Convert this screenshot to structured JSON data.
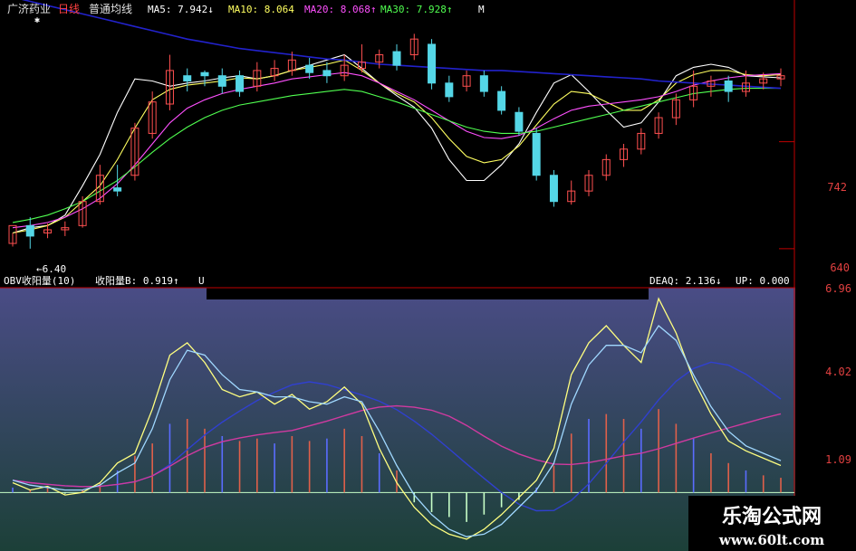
{
  "header": {
    "stock_name": "广济药业",
    "period": "日线",
    "indicator_name": "普通均线",
    "ma5": "MA5: 7.942↓",
    "ma10": "MA10: 8.064",
    "ma20": "MA20: 8.068↑",
    "ma30": "MA30: 7.928↑",
    "overflow_mark": "M"
  },
  "price_panel": {
    "min_marker": "6.40",
    "axis_labels": [
      "742",
      "640"
    ]
  },
  "sub_panel": {
    "indicator_title": "OBV收阳量(10)",
    "field1": "收阳量B: 0.919↑",
    "clipped_mark": "U",
    "field2": "DEAQ: 2.136↓",
    "field3": "UP: 0.000",
    "axis_labels": [
      "6.96",
      "4.02",
      "1.09"
    ]
  },
  "watermark": {
    "brand": "乐淘公式网",
    "url": "www.60lt.com"
  },
  "colors": {
    "background": "#000000",
    "up_candle": "#ff5050",
    "down_candle": "#54d6e6",
    "ma5": "#ffffff",
    "ma10": "#ffff60",
    "ma20": "#ff50ff",
    "ma30": "#50ff50",
    "long_ma": "#2222cc",
    "axis": "#c00000",
    "sub_bg_top": "#4a4c86",
    "sub_bg_bottom": "#1c4038"
  },
  "chart_data": [
    {
      "type": "candlestick",
      "title": "广济药业 日线",
      "ylim": [
        6.2,
        8.6
      ],
      "axis_labels": [
        "742",
        "640"
      ],
      "min_annotation": 6.4,
      "series": [
        {
          "name": "MA5",
          "values": [
            6.55,
            6.6,
            6.62,
            6.72,
            7.0,
            7.3,
            7.7,
            8.02,
            8.0,
            7.95,
            7.98,
            8.0,
            8.03,
            8.05,
            8.02,
            8.05,
            8.1,
            8.15,
            8.2,
            8.25,
            8.12,
            7.98,
            7.86,
            7.75,
            7.55,
            7.25,
            7.05,
            7.05,
            7.2,
            7.4,
            7.7,
            7.98,
            8.06,
            7.9,
            7.72,
            7.56,
            7.6,
            7.8,
            8.05,
            8.13,
            8.16,
            8.13,
            8.05,
            8.04,
            8.03
          ]
        },
        {
          "name": "MA10",
          "values": [
            6.55,
            6.58,
            6.62,
            6.7,
            6.85,
            7.0,
            7.25,
            7.55,
            7.82,
            7.92,
            7.96,
            7.98,
            8.0,
            8.03,
            8.02,
            8.05,
            8.1,
            8.13,
            8.16,
            8.2,
            8.1,
            7.98,
            7.88,
            7.8,
            7.65,
            7.45,
            7.28,
            7.22,
            7.25,
            7.38,
            7.58,
            7.78,
            7.9,
            7.88,
            7.8,
            7.72,
            7.72,
            7.82,
            7.98,
            8.06,
            8.1,
            8.1,
            8.06,
            8.05,
            8.06
          ]
        },
        {
          "name": "MA20",
          "values": [
            6.6,
            6.62,
            6.65,
            6.7,
            6.78,
            6.88,
            7.02,
            7.2,
            7.4,
            7.6,
            7.74,
            7.82,
            7.88,
            7.92,
            7.95,
            7.98,
            8.02,
            8.04,
            8.06,
            8.08,
            8.05,
            7.98,
            7.9,
            7.82,
            7.72,
            7.62,
            7.52,
            7.46,
            7.45,
            7.48,
            7.55,
            7.64,
            7.72,
            7.76,
            7.78,
            7.8,
            7.82,
            7.85,
            7.9,
            7.96,
            8.0,
            8.03,
            8.05,
            8.06,
            8.07
          ]
        },
        {
          "name": "MA30",
          "values": [
            6.65,
            6.68,
            6.72,
            6.78,
            6.85,
            6.95,
            7.05,
            7.18,
            7.32,
            7.45,
            7.56,
            7.65,
            7.72,
            7.77,
            7.8,
            7.83,
            7.86,
            7.88,
            7.9,
            7.92,
            7.9,
            7.85,
            7.8,
            7.74,
            7.68,
            7.62,
            7.56,
            7.52,
            7.5,
            7.5,
            7.52,
            7.56,
            7.6,
            7.64,
            7.68,
            7.72,
            7.76,
            7.8,
            7.84,
            7.88,
            7.9,
            7.92,
            7.93,
            7.93,
            7.93
          ]
        },
        {
          "name": "long MA",
          "values": [
            8.8,
            8.76,
            8.72,
            8.68,
            8.64,
            8.6,
            8.56,
            8.52,
            8.48,
            8.44,
            8.4,
            8.37,
            8.34,
            8.31,
            8.29,
            8.27,
            8.25,
            8.23,
            8.21,
            8.2,
            8.18,
            8.16,
            8.15,
            8.14,
            8.13,
            8.12,
            8.11,
            8.1,
            8.1,
            8.09,
            8.08,
            8.07,
            8.06,
            8.05,
            8.04,
            8.03,
            8.02,
            8.0,
            7.99,
            7.98,
            7.97,
            7.96,
            7.95,
            7.94,
            7.93
          ]
        }
      ],
      "candles": [
        [
          6.45,
          6.62,
          6.55,
          6.42
        ],
        [
          6.62,
          6.52,
          6.7,
          6.4
        ],
        [
          6.55,
          6.58,
          6.64,
          6.5
        ],
        [
          6.58,
          6.6,
          6.66,
          6.52
        ],
        [
          6.62,
          6.85,
          6.9,
          6.6
        ],
        [
          6.85,
          7.1,
          7.2,
          6.82
        ],
        [
          6.98,
          6.95,
          7.2,
          6.9
        ],
        [
          7.1,
          7.55,
          7.6,
          7.05
        ],
        [
          7.5,
          7.8,
          7.9,
          7.45
        ],
        [
          7.78,
          8.1,
          8.25,
          7.72
        ],
        [
          8.05,
          8.0,
          8.12,
          7.9
        ],
        [
          8.08,
          8.05,
          8.1,
          7.95
        ],
        [
          8.05,
          7.95,
          8.12,
          7.88
        ],
        [
          8.05,
          7.9,
          8.1,
          7.85
        ],
        [
          7.95,
          8.1,
          8.18,
          7.9
        ],
        [
          8.05,
          8.12,
          8.2,
          8.0
        ],
        [
          8.1,
          8.2,
          8.28,
          8.05
        ],
        [
          8.15,
          8.08,
          8.22,
          8.02
        ],
        [
          8.1,
          8.05,
          8.18,
          7.98
        ],
        [
          8.05,
          8.15,
          8.25,
          8.0
        ],
        [
          8.12,
          8.18,
          8.35,
          8.08
        ],
        [
          8.18,
          8.25,
          8.3,
          8.12
        ],
        [
          8.28,
          8.15,
          8.35,
          8.1
        ],
        [
          8.25,
          8.4,
          8.45,
          8.2
        ],
        [
          8.35,
          7.98,
          8.4,
          7.92
        ],
        [
          7.98,
          7.85,
          8.05,
          7.8
        ],
        [
          7.95,
          8.05,
          8.1,
          7.9
        ],
        [
          8.05,
          7.9,
          8.1,
          7.85
        ],
        [
          7.9,
          7.72,
          7.95,
          7.68
        ],
        [
          7.7,
          7.52,
          7.75,
          7.48
        ],
        [
          7.5,
          7.1,
          7.55,
          7.05
        ],
        [
          7.1,
          6.85,
          7.15,
          6.8
        ],
        [
          6.85,
          6.95,
          7.05,
          6.82
        ],
        [
          6.95,
          7.1,
          7.15,
          6.9
        ],
        [
          7.1,
          7.25,
          7.3,
          7.05
        ],
        [
          7.25,
          7.35,
          7.4,
          7.18
        ],
        [
          7.35,
          7.5,
          7.55,
          7.3
        ],
        [
          7.5,
          7.65,
          7.7,
          7.45
        ],
        [
          7.65,
          7.82,
          7.88,
          7.58
        ],
        [
          7.82,
          7.95,
          8.1,
          7.75
        ],
        [
          7.95,
          8.0,
          8.05,
          7.85
        ],
        [
          8.0,
          7.9,
          8.05,
          7.8
        ],
        [
          7.9,
          7.98,
          8.1,
          7.85
        ],
        [
          7.98,
          8.02,
          8.08,
          7.92
        ],
        [
          8.02,
          8.05,
          8.12,
          7.95
        ]
      ]
    },
    {
      "type": "line",
      "title": "OBV收阳量(10)",
      "ylim": [
        -2.2,
        8.2
      ],
      "axis_labels": [
        "6.96",
        "4.02",
        "1.09"
      ],
      "series": [
        {
          "name": "收阳量B",
          "values": [
            0.4,
            0.1,
            0.25,
            -0.1,
            0.0,
            0.4,
            1.2,
            1.6,
            3.4,
            5.6,
            6.1,
            5.3,
            4.2,
            3.9,
            4.1,
            3.6,
            4.0,
            3.4,
            3.7,
            4.3,
            3.6,
            1.8,
            0.4,
            -0.6,
            -1.3,
            -1.7,
            -1.9,
            -1.5,
            -0.9,
            -0.2,
            0.5,
            1.8,
            4.8,
            6.1,
            6.8,
            6.0,
            5.3,
            7.9,
            6.5,
            4.6,
            3.2,
            2.1,
            1.7,
            1.4,
            1.1
          ]
        },
        {
          "name": "DEAQ",
          "values": [
            0.5,
            0.3,
            0.2,
            0.1,
            0.1,
            0.3,
            0.8,
            1.2,
            2.6,
            4.6,
            5.8,
            5.6,
            4.8,
            4.2,
            4.1,
            3.9,
            3.9,
            3.7,
            3.6,
            3.9,
            3.7,
            2.5,
            1.1,
            -0.1,
            -0.9,
            -1.5,
            -1.8,
            -1.7,
            -1.3,
            -0.6,
            0.1,
            1.2,
            3.6,
            5.2,
            6.0,
            6.0,
            5.7,
            6.8,
            6.2,
            4.8,
            3.5,
            2.5,
            1.9,
            1.6,
            1.3
          ]
        }
      ],
      "bars": [
        0.2,
        0.1,
        0.2,
        -0.05,
        0.1,
        0.4,
        0.9,
        1.5,
        2.0,
        2.8,
        3.0,
        2.6,
        2.3,
        2.1,
        2.2,
        2.0,
        2.3,
        2.1,
        2.2,
        2.6,
        2.3,
        1.6,
        0.9,
        -0.4,
        -0.8,
        -1.0,
        -1.2,
        -0.9,
        -0.6,
        -0.3,
        0.2,
        1.1,
        2.4,
        3.0,
        3.2,
        3.0,
        2.6,
        3.4,
        2.8,
        2.2,
        1.6,
        1.2,
        0.9,
        0.7,
        0.6
      ]
    }
  ]
}
